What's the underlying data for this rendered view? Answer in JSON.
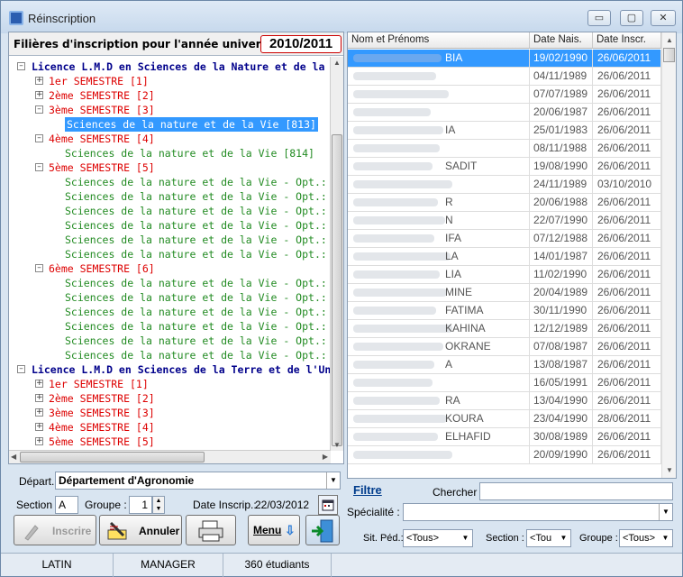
{
  "window": {
    "title": "Réinscription",
    "minimize": "▭",
    "maximize": "▢",
    "close": "✕"
  },
  "filieres": {
    "label": "Filières d'inscription pour l'année universitaire :",
    "year": "2010/2011",
    "tree": [
      {
        "text": "Licence L.M.D en Sciences de la Nature et de la Vie",
        "kind": "root",
        "exp": "–"
      },
      {
        "text": "1er SEMESTRE  [1]",
        "kind": "sem",
        "exp": "+"
      },
      {
        "text": "2ème SEMESTRE  [2]",
        "kind": "sem",
        "exp": "+"
      },
      {
        "text": "3ème SEMESTRE  [3]",
        "kind": "sem",
        "exp": "–"
      },
      {
        "text": "Sciences de la nature et de la Vie [813]",
        "kind": "leaf",
        "selected": true
      },
      {
        "text": "4ème SEMESTRE  [4]",
        "kind": "sem",
        "exp": "–"
      },
      {
        "text": "Sciences de la nature et de la Vie [814]",
        "kind": "leaf"
      },
      {
        "text": "5ème SEMESTRE  [5]",
        "kind": "sem",
        "exp": "–"
      },
      {
        "text": "Sciences de la nature et de la Vie - Opt.: Ecologie et",
        "kind": "leaf"
      },
      {
        "text": "Sciences de la nature et de la Vie - Opt.: Biochimie",
        "kind": "leaf"
      },
      {
        "text": "Sciences de la nature et de la Vie - Opt.: Microbiolo",
        "kind": "leaf"
      },
      {
        "text": "Sciences de la nature et de la Vie - Opt.: Ecologie et",
        "kind": "leaf"
      },
      {
        "text": "Sciences de la nature et de la Vie - Opt.: Bio Ecolo",
        "kind": "leaf"
      },
      {
        "text": "Sciences de la nature et de la Vie - Opt.: Physiolog",
        "kind": "leaf"
      },
      {
        "text": "6ème SEMESTRE  [6]",
        "kind": "sem",
        "exp": "–"
      },
      {
        "text": "Sciences de la nature et de la Vie - Opt.: Ecologie et",
        "kind": "leaf"
      },
      {
        "text": "Sciences de la nature et de la Vie - Opt.: Biochimie",
        "kind": "leaf"
      },
      {
        "text": "Sciences de la nature et de la Vie - Opt.: Microbiolo",
        "kind": "leaf"
      },
      {
        "text": "Sciences de la nature et de la Vie - Opt.: Ecologie et",
        "kind": "leaf"
      },
      {
        "text": "Sciences de la nature et de la Vie - Opt.: Bio Ecolo",
        "kind": "leaf"
      },
      {
        "text": "Sciences de la nature et de la Vie - Opt.: Physiolog",
        "kind": "leaf"
      },
      {
        "text": "Licence L.M.D en Sciences de la Terre et de l'Univers",
        "kind": "root",
        "exp": "–"
      },
      {
        "text": "1er SEMESTRE  [1]",
        "kind": "sem",
        "exp": "+"
      },
      {
        "text": "2ème SEMESTRE  [2]",
        "kind": "sem",
        "exp": "+"
      },
      {
        "text": "3ème SEMESTRE  [3]",
        "kind": "sem",
        "exp": "+"
      },
      {
        "text": "4ème SEMESTRE  [4]",
        "kind": "sem",
        "exp": "+"
      },
      {
        "text": "5ème SEMESTRE  [5]",
        "kind": "sem",
        "exp": "+"
      }
    ]
  },
  "form": {
    "depart_label": "Départ.:",
    "depart_value": "Département d'Agronomie",
    "section_label": "Section :",
    "section_value": "A",
    "groupe_label": "Groupe :",
    "groupe_value": "1",
    "date_label": "Date Inscrip.:",
    "date_value": "22/03/2012",
    "buttons": {
      "inscrire": "Inscrire",
      "annuler": "Annuler",
      "menu": "Menu"
    }
  },
  "table": {
    "headers": [
      "Nom et Prénoms",
      "Date Nais.",
      "Date Inscr."
    ],
    "rows": [
      {
        "name": "BIA",
        "nais": "19/02/1990",
        "inscr": "26/06/2011",
        "selected": true
      },
      {
        "name": "",
        "nais": "04/11/1989",
        "inscr": "26/06/2011"
      },
      {
        "name": "",
        "nais": "07/07/1989",
        "inscr": "26/06/2011"
      },
      {
        "name": "",
        "nais": "20/06/1987",
        "inscr": "26/06/2011"
      },
      {
        "name": "IA",
        "nais": "25/01/1983",
        "inscr": "26/06/2011"
      },
      {
        "name": "",
        "nais": "08/11/1988",
        "inscr": "26/06/2011"
      },
      {
        "name": "SADIT",
        "nais": "19/08/1990",
        "inscr": "26/06/2011"
      },
      {
        "name": "",
        "nais": "24/11/1989",
        "inscr": "03/10/2010"
      },
      {
        "name": "R",
        "nais": "20/06/1988",
        "inscr": "26/06/2011"
      },
      {
        "name": "N",
        "nais": "22/07/1990",
        "inscr": "26/06/2011"
      },
      {
        "name": "IFA",
        "nais": "07/12/1988",
        "inscr": "26/06/2011"
      },
      {
        "name": "LA",
        "nais": "14/01/1987",
        "inscr": "26/06/2011"
      },
      {
        "name": "LIA",
        "nais": "11/02/1990",
        "inscr": "26/06/2011"
      },
      {
        "name": "MINE",
        "nais": "20/04/1989",
        "inscr": "26/06/2011"
      },
      {
        "name": "FATIMA",
        "nais": "30/11/1990",
        "inscr": "26/06/2011"
      },
      {
        "name": "KAHINA",
        "nais": "12/12/1989",
        "inscr": "26/06/2011"
      },
      {
        "name": "OKRANE",
        "nais": "07/08/1987",
        "inscr": "26/06/2011"
      },
      {
        "name": "A",
        "nais": "13/08/1987",
        "inscr": "26/06/2011"
      },
      {
        "name": "",
        "nais": "16/05/1991",
        "inscr": "26/06/2011"
      },
      {
        "name": "RA",
        "nais": "13/04/1990",
        "inscr": "26/06/2011"
      },
      {
        "name": "KOURA",
        "nais": "23/04/1990",
        "inscr": "28/06/2011"
      },
      {
        "name": "ELHAFID",
        "nais": "30/08/1989",
        "inscr": "26/06/2011"
      },
      {
        "name": "",
        "nais": "20/09/1990",
        "inscr": "26/06/2011"
      }
    ]
  },
  "filter": {
    "title": "Filtre",
    "chercher_label": "Chercher :",
    "specialite_label": "Spécialité :",
    "sitped_label": "Sit. Péd.:",
    "sitped_value": "<Tous>",
    "section_label": "Section :",
    "section_value": "<Tou",
    "groupe_label": "Groupe :",
    "groupe_value": "<Tous>"
  },
  "status": {
    "lang": "LATIN",
    "role": "MANAGER",
    "count": "360 étudiants"
  }
}
